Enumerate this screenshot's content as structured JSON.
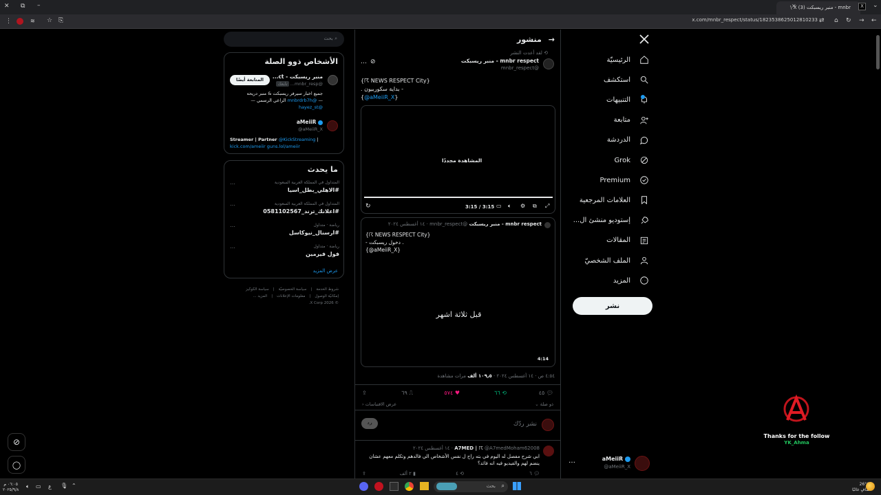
{
  "browser": {
    "tab_title": "mnbr - منبر ريسبكت (3) X \\",
    "tab_x_letter": "X",
    "url": "x.com/mnbr_respect/status/1823538625012810233",
    "new_tab": "+",
    "close_tab": "×"
  },
  "nav": {
    "items": [
      {
        "label": "الرئيسيّة",
        "icon": "home-icon"
      },
      {
        "label": "استكشف",
        "icon": "search-icon"
      },
      {
        "label": "التنبيهات",
        "icon": "bell-icon"
      },
      {
        "label": "متابعة",
        "icon": "person-add-icon"
      },
      {
        "label": "الدردشة",
        "icon": "chat-icon"
      },
      {
        "label": "Grok",
        "icon": "grok-icon"
      },
      {
        "label": "Premium",
        "icon": "premium-icon"
      },
      {
        "label": "العلامات المرجعية",
        "icon": "bookmark-icon"
      },
      {
        "label": "إستوديو منشئ ال...",
        "icon": "rocket-icon"
      },
      {
        "label": "المقالات",
        "icon": "article-icon"
      },
      {
        "label": "الملف الشخصيّ",
        "icon": "profile-icon"
      },
      {
        "label": "المزيد",
        "icon": "more-icon"
      }
    ],
    "post_button": "نشر",
    "account_name": "aMeiiR",
    "account_handle": "@aMeiiR_X",
    "account_more": "…"
  },
  "header": {
    "title": "منشور",
    "back": "→"
  },
  "post": {
    "repost_note": "لقد أعدت النشر",
    "author_name": "mnbr respect - منبر ريسبكت",
    "author_handle": "@mnbr_respect",
    "line1": "{☈ NEWS RESPECT City}",
    "line2": "- بداية سكوربيون .",
    "line3_prefix": "{",
    "line3_link": "@aMeiiR_X",
    "line3_suffix": "}",
    "replay_label": "المشاهدة مجددًا",
    "video_time": "3:15 / 3:15",
    "progress": 1.0,
    "meta_time": "٤:٥٤ ص · ١٤ أغسطس ٢٠٢٤ · ",
    "meta_views_num": "١٠٩٫٥ ألف",
    "meta_views_label": " مرات مشاهدة",
    "reply_count": "٤٥",
    "repost_count": "٦٦",
    "like_count": "٥٧٤",
    "bookmark_count": "٦٩",
    "quotes_link": "عرض الاقتباسات",
    "replies_sort": "ذو صلة"
  },
  "quote": {
    "author_name": "mnbr respect - منبر ريسبكت",
    "author_handle": "@mnbr_respect",
    "date": "١٤ أغسطس ٢٠٢٤",
    "line1": "{☈ NEWS RESPECT City}",
    "line2": "- دخول ريسبكت .",
    "line3": "{@aMeiiR_X}",
    "overlay_text": "قبل ثلاثة اشهر",
    "duration": "4:14"
  },
  "reply_box": {
    "placeholder": "نشر ردّك",
    "button": "رد"
  },
  "reply": {
    "author_name": "A7MED | ☈",
    "author_handle": "@A7medMoham62008",
    "date": "١٤ أغسطس ٢٠٢٤",
    "text": "ابي شرح مفصل له اليوم في بته راح ل نفس الأشخاص الي فالدهم وتكلم معهم عشان ينضم لهم والفيديو فيه انه فائد؟",
    "reply_count": "٦",
    "repost_count": "٤",
    "views": "٢ ألف"
  },
  "sidebar": {
    "search_placeholder": "بحث",
    "relevant_title": "الأشخاص ذوو الصلة",
    "people": [
      {
        "name": "منبر ريسبكت - ct...",
        "handle": "@mnbr_resp...",
        "badge": "تابعك",
        "button": "المتابعة أيضًا",
        "bio_line1": "جميع اخبار سيرفر ريسبكت & منبر دريحه",
        "bio_line2_prefix": "— ",
        "bio_line2_link": "@mnbrdrb7h",
        "bio_line2_suffix": " الراعي الرسمي —",
        "bio_line3_link": "@hayez_st"
      },
      {
        "name": "aMeiiR",
        "handle": "@aMeiiR_X",
        "bio_line1_prefix": "Streamer | Partner ",
        "bio_line1_link": "@KickStreaming",
        "bio_line1_suffix": " |",
        "bio_line2": "kick.com/ameiir guns.lol/ameiir"
      }
    ],
    "trending_title": "ما يحدث",
    "trends": [
      {
        "category": "المتداول في المملكة العربية السعودية",
        "name": "#الاهلي_بطل_اسيا"
      },
      {
        "category": "المتداول في المملكة العربية السعودية",
        "name": "#اعلانك_ترند_0581102567"
      },
      {
        "category": "رياضة · متداول",
        "name": "#ارسنال_نيوكاسل"
      },
      {
        "category": "رياضة · متداول",
        "name": "فول فيرمين"
      }
    ],
    "show_more": "عرض المزيد",
    "footer_row1": [
      "شروط الخدمة",
      "سياسة الخصوصيّة",
      "سياسة الكوكيز"
    ],
    "footer_row2": [
      "إمكانيّة الوصول",
      "معلومات الإعلانات",
      "المزيد ..."
    ],
    "footer_row3": "© 2026 X Corp."
  },
  "overlay": {
    "thanks_line1": "Thanks for the follow",
    "thanks_line2": "YK_Ahma"
  },
  "taskbar": {
    "search_placeholder": "بحث",
    "weather_temp": "26°C",
    "weather_desc": "صافٍ غالبًا",
    "time": "٠٦:٠٥ م",
    "date": "٢٠٢٥/٩/٨",
    "lang": "ع"
  },
  "colors": {
    "accent": "#1d9bf0",
    "like": "#f91880",
    "repost": "#00ba7c",
    "border": "#2f3336",
    "muted": "#71767b"
  }
}
